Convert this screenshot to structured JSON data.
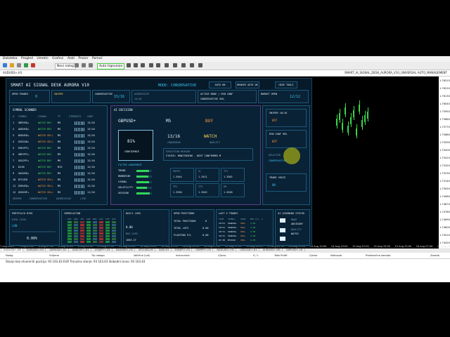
{
  "menu": [
    "Datoteka",
    "Pregled",
    "Umetni",
    "Grafovi",
    "Alati",
    "Prozor",
    "Pomoć"
  ],
  "toolbar": {
    "new_order": "Novi nalog",
    "auto_trading": "Auto trgovanje"
  },
  "window": {
    "left": "AUDUSD+,H1",
    "right": "SMART_AI_SIGNAL_DESK_AURORA_V10_UNIVERSAL AUTO_MANAGEMENT"
  },
  "dashboard": {
    "title": "SMART AI SIGNAL DESK AURORA V10",
    "mode": "MODE: CONSERVATIVE",
    "auto_btn": "AUTO ON",
    "broker_btn": "BROKER AUTO OK",
    "hide_btn": "HIDE TOOLS",
    "open_trades_label": "OPEN TRADES",
    "open_trades_value": "0",
    "sniper_label": "SNIPER",
    "conservative_label": "CONSERVATIVE",
    "conservative_value": "15/16",
    "aggressive_label": "AGGRESSIVE",
    "aggressive_value": "15/16",
    "active_mode_label": "ACTIVE MODE / MIN CONF",
    "active_mode_value": "CONSERVATIVE 80%",
    "market_open_label": "MARKET OPEN",
    "market_open_value": "12/12",
    "scanner_title": "SYMBOL SCANNER",
    "scanner_header": [
      "#",
      "SYMBOL",
      "SIGNAL",
      "TF",
      "STRENGTH",
      "CONF"
    ],
    "scanner": [
      {
        "n": "1",
        "sym": "GBPUSD+",
        "sig": "WATCH BUY",
        "tf": "M5",
        "conf": "13/16"
      },
      {
        "n": "2",
        "sym": "AUDUSD+",
        "sig": "WATCH BUY",
        "tf": "M5",
        "conf": "13/16"
      },
      {
        "n": "3",
        "sym": "NZDUSD+",
        "sig": "WATCH SELL",
        "tf": "M5",
        "conf": "13/16"
      },
      {
        "n": "4",
        "sym": "USDCAD+",
        "sig": "WATCH SELL",
        "tf": "M5",
        "conf": "13/16"
      },
      {
        "n": "5",
        "sym": "EURJPY+",
        "sig": "WATCH BUY",
        "tf": "M5",
        "conf": "13/16"
      },
      {
        "n": "6",
        "sym": "GBPJPY+",
        "sig": "WATCH BUY",
        "tf": "M5",
        "conf": "12/16"
      },
      {
        "n": "7",
        "sym": "USDJPY+",
        "sig": "WATCH BUY",
        "tf": "M5",
        "conf": "12/16"
      },
      {
        "n": "8",
        "sym": "DJ30",
        "sig": "WATCH BUY",
        "tf": "M15",
        "conf": "12/16"
      },
      {
        "n": "9",
        "sym": "XAUUSD+",
        "sig": "WATCH BUY",
        "tf": "M5",
        "conf": "12/16"
      },
      {
        "n": "10",
        "sym": "BTCUSD",
        "sig": "WATCH SELL",
        "tf": "M5",
        "conf": "12/16"
      },
      {
        "n": "11",
        "sym": "EURUSD+",
        "sig": "WATCH SELL",
        "tf": "M5",
        "conf": "12/16"
      },
      {
        "n": "12",
        "sym": "USDCHF+",
        "sig": "WATCH SELL",
        "tf": "M5",
        "conf": "11/16"
      }
    ],
    "scanner_footer": [
      "SNIPER",
      "CONSERVATIVE",
      "AGGRESSIVE",
      "LIVE"
    ],
    "ai_title": "AI DECISION",
    "ai_symbol": "GBPUSD+",
    "ai_tf": "M5",
    "ai_signal": "BUY",
    "confidence_value": "81%",
    "confidence_label": "CONFIDENCE",
    "score_value": "13/16",
    "score_label": "CONSENSUS",
    "quality_value": "WATCH",
    "quality_label": "QUALITY",
    "status_label": "EXECUTION REASON",
    "status_text": "STATUS: MONITORING - NEXT CONFIRMED M",
    "filter_title": "FILTER AGREEMENT",
    "filters": [
      {
        "name": "TREND",
        "pct": 0.81
      },
      {
        "name": "MOMENTUM",
        "pct": 0.75
      },
      {
        "name": "SIGNAL",
        "pct": 0.8
      },
      {
        "name": "VOLATILITY",
        "pct": 0.7
      },
      {
        "name": "SESSION",
        "pct": 0.85
      }
    ],
    "levels": [
      {
        "label": "ENTRY",
        "value": "1.3444"
      },
      {
        "label": "SL",
        "value": "1.3411"
      },
      {
        "label": "TP1",
        "value": "1.3502"
      },
      {
        "label": "TP2",
        "value": "1.3530"
      },
      {
        "label": "TP3",
        "value": "1.3545"
      },
      {
        "label": "RR",
        "value": "1.5528"
      }
    ],
    "sniper_panel_label": "SNIPER 16/16",
    "sniper_panel_value": "OFF",
    "min_conf_label": "MIN CONF 90%",
    "min_conf_value": "OFF",
    "selected_label": "SELECTED",
    "selected_value": "CONSERVATIVE",
    "trade_voice_label": "TRADE VOICE",
    "trade_voice_value": "ON",
    "portfolio_title": "PORTFOLIO RISK",
    "risk_label": "RISK LEVEL",
    "risk_value": "LOW",
    "risk_pct": "0.00%",
    "correlation_title": "CORRELATION",
    "correlation_cols": [
      "EUR",
      "GBP",
      "JPY",
      "AUD",
      "NZD",
      "CAD",
      "CHF",
      "USD"
    ],
    "daily_loss_title": "DAILY LOSS",
    "daily_loss_value": "0.00",
    "daily_loss_max_label": "MAX LOSS",
    "daily_loss_max": "1663.27",
    "open_positions_title": "OPEN POSITIONS",
    "total_positions_label": "TOTAL POSITIONS",
    "total_positions_value": "0",
    "total_lots_label": "TOTAL LOTS",
    "total_lots_value": "0.00",
    "floating_label": "FLOATING P/L",
    "floating_value": "0.00",
    "last5_title": "LAST 5 TRADES",
    "last5_header": [
      "TIME",
      "SYMBOL",
      "SIDE",
      "NET P/L",
      "S"
    ],
    "last5": [
      {
        "time": "10:51",
        "sym": "XAUUSD+",
        "side": "SELL",
        "pl": "4.99"
      },
      {
        "time": "10:51",
        "sym": "XAUUSD+",
        "side": "SELL",
        "pl": "4.99"
      },
      {
        "time": "10:31",
        "sym": "XAUUSD+",
        "side": "SELL",
        "pl": "4.99"
      },
      {
        "time": "10:31",
        "sym": "XAUUSD+",
        "side": "SELL",
        "pl": "4.99"
      },
      {
        "time": "07:38",
        "sym": "BTCUSD",
        "side": "SELL",
        "pl": "6.38"
      }
    ],
    "learning_title": "AI LEARNING STATUS",
    "learning_mode_label": "MODE",
    "learning_mode_value": "ADVISORY",
    "learning_quality_label": "QUALITY",
    "learning_quality_value": "WATCH"
  },
  "price_axis": [
    "1.76310",
    "1.76220",
    "1.76130",
    "1.76040",
    "1.75950",
    "1.75860",
    "1.75770",
    "1.75680",
    "1.75590",
    "1.75500",
    "1.75410",
    "1.75320",
    "1.75230",
    "1.75140",
    "1.75050",
    "1.74960",
    "1.74870",
    "1.74780",
    "1.74690",
    "1.74600",
    "1.74510",
    "1.74420"
  ],
  "time_axis": [
    "7 Aug 2025",
    "7 Aug 23:00",
    "8 Aug 07:00",
    "8 Aug 15:00",
    "8 Aug 23:00",
    "11 Aug 07:00",
    "11 Aug 15:00",
    "11 Aug 23:00",
    "12 Aug 07:00",
    "12 Aug 15:00",
    "12 Aug 23:00",
    "13 Aug 07:00",
    "13 Aug 15:00",
    "13 Aug 23:00",
    "14 Aug 07:00",
    "14 Aug 15:00",
    "14 Aug 23:00",
    "15 Aug 07:00",
    "15 Aug 15:00",
    "15 Aug 23:00",
    "18 Aug 07:00",
    "18 Aug 15:00",
    "18 Aug 23:00",
    "19 Aug 07:00",
    "19 Aug 15:00"
  ],
  "tabs": [
    "AUDUSD+,M5",
    "EURUSD+,H1",
    "GBPUSD+,H1",
    "USDCHF+,H1",
    "USDJPY+,H1",
    "XAUUSD+,H1",
    "BTCUSD,H1",
    "DJ30,H1",
    "EURJPY+,H1",
    "GBPJPY+,H1",
    "NZDUSD+,H1",
    "USDCAD+,H1",
    "AUDUSD+,M5",
    "GBPUSD+,H1"
  ],
  "terminal": {
    "headers": [
      "Nalog",
      "Vrijeme",
      "Tip naloga",
      "Veličina (Lot)",
      "Instrument",
      "Cijena",
      "S / L",
      "Take Profit",
      "Cijena",
      "Naknada",
      "Prekonoćna kamata",
      "Zarada"
    ],
    "status": "Stanje bez otvorenih pozicija: 93 163.63 EUR  Trenutno stanje: 93 163.63  Slobodni iznos: 93 163.63"
  }
}
